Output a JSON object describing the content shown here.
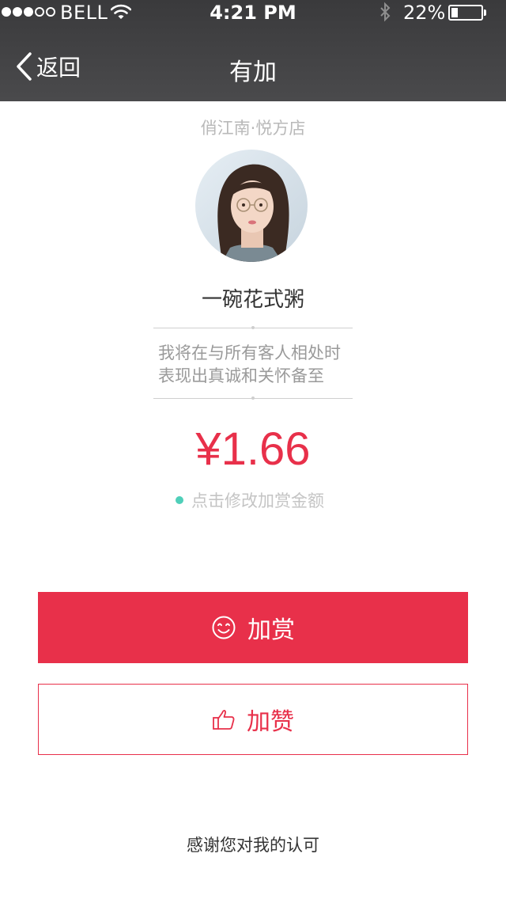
{
  "status_bar": {
    "carrier": "BELL",
    "time": "4:21 PM",
    "battery_percent": "22%",
    "battery_level": 0.22,
    "signal_bars": 3,
    "signal_total": 5,
    "icons": [
      "wifi-icon",
      "bluetooth-icon",
      "battery-icon"
    ]
  },
  "nav": {
    "back_label": "返回",
    "title": "有加"
  },
  "profile": {
    "store": "俏江南·悦方店",
    "name": "一碗花式粥",
    "motto_line1": "我将在与所有客人相处时",
    "motto_line2": "表现出真诚和关怀备至"
  },
  "reward": {
    "amount": "¥1.66",
    "edit_hint": "点击修改加赏金额"
  },
  "actions": {
    "reward_label": "加赏",
    "reward_icon": "smile-icon",
    "like_label": "加赞",
    "like_icon": "thumbs-up-icon"
  },
  "footer": {
    "thanks": "感谢您对我的认可"
  },
  "colors": {
    "accent": "#e8304a",
    "hint_dot": "#4fcfb9",
    "nav_bar": "#3a3a3c"
  }
}
